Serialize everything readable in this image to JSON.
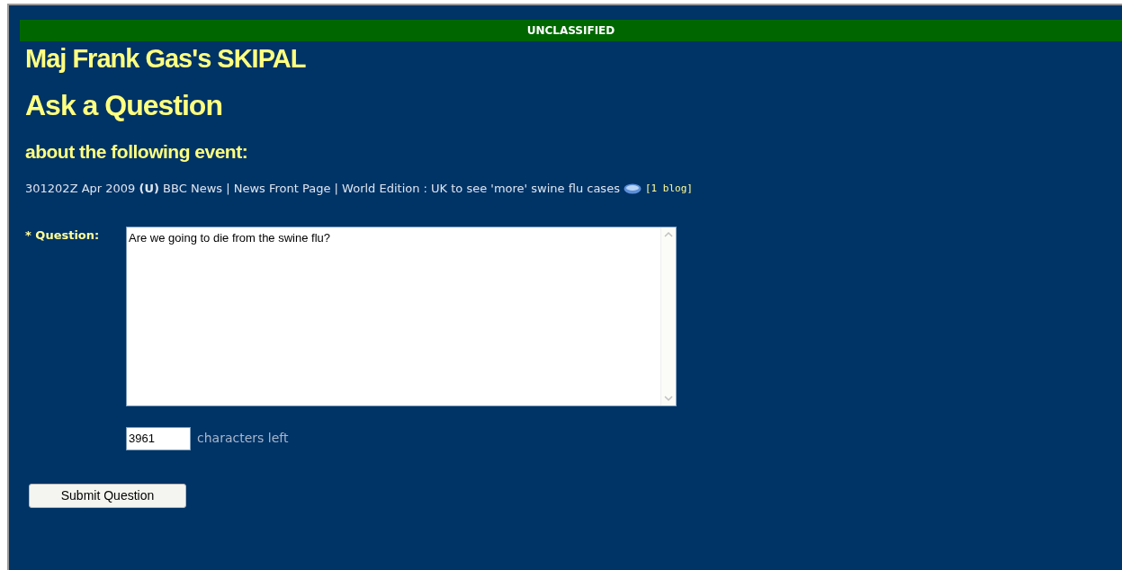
{
  "banner": "UNCLASSIFIED",
  "title": "Maj Frank Gas's SKIPAL",
  "heading": "Ask a Question",
  "subheading": "about the following event:",
  "event": {
    "text": "301202Z Apr 2009 **(U)** BBC News | News Front Page | World Edition : UK to see 'more' swine flu cases",
    "link": "[1 blog]"
  },
  "question": {
    "label": "* Question:",
    "value": "Are we going to die from the swine flu?"
  },
  "counter": {
    "value": "3961",
    "label": "characters left"
  },
  "submit": "Submit Question"
}
